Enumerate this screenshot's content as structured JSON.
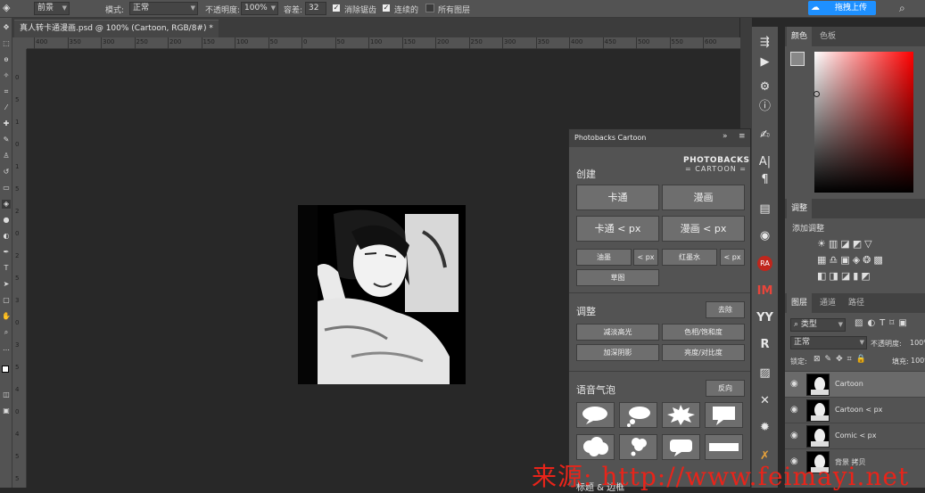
{
  "options_bar": {
    "mode_select": "前景",
    "mode_label": "模式:",
    "blend_select": "正常",
    "opacity_label": "不透明度:",
    "opacity_value": "100%",
    "tolerance_label": "容差:",
    "tolerance_value": "32",
    "antialias_label": "消除锯齿",
    "contiguous_label": "连续的",
    "all_layers_label": "所有图层",
    "upload_button": "拖拽上传"
  },
  "document": {
    "tab_title": "真人转卡通漫画.psd @ 100% (Cartoon, RGB/8#) *",
    "ruler_ticks": [
      "400",
      "350",
      "300",
      "250",
      "200",
      "150",
      "100",
      "50",
      "0",
      "50",
      "100",
      "150",
      "200",
      "250",
      "300",
      "350",
      "400",
      "450",
      "500",
      "550",
      "600",
      "650",
      "700",
      "750",
      "800",
      "850",
      "900",
      "950"
    ],
    "vruler_ticks": [
      "0",
      "5",
      "1",
      "0",
      "1",
      "5",
      "2",
      "0",
      "2",
      "5",
      "3",
      "0",
      "3",
      "5",
      "4",
      "0",
      "4",
      "5",
      "5"
    ]
  },
  "photobacks": {
    "title": "Photobacks Cartoon",
    "logo_line1": "PHOTOBACKS",
    "logo_line2": "= CARTOON =",
    "create_label": "创建",
    "cartoon_btn": "卡通",
    "comic_btn": "漫画",
    "cartoon_px_btn": "卡通 < px",
    "comic_px_btn": "漫画 < px",
    "oil_btn": "油墨",
    "oil_px_btn": "< px",
    "red_btn": "红墨水",
    "red_px_btn": "< px",
    "sketch_btn": "草图",
    "adjust_label": "调整",
    "remove_btn": "去除",
    "reduce_highlight_btn": "减淡高光",
    "hue_sat_btn": "色相/饱和度",
    "deepen_shadow_btn": "加深阴影",
    "brightness_btn": "亮度/对比度",
    "bubbles_label": "语音气泡",
    "invert_btn": "反向",
    "bottom_label": "标题 & 边框"
  },
  "right_panel": {
    "color_tab": "颜色",
    "swatch_tab": "色板",
    "adjust_tab": "调整",
    "add_adjust_label": "添加调整",
    "layers_tab": "图层",
    "channels_tab": "通道",
    "paths_tab": "路径",
    "kind_select": "类型",
    "blend_select": "正常",
    "opacity_label": "不透明度:",
    "opacity_value": "100%",
    "lock_label": "锁定:",
    "fill_label": "填充:",
    "fill_value": "100%",
    "layers": [
      {
        "name": "Cartoon"
      },
      {
        "name": "Cartoon < px"
      },
      {
        "name": "Comic < px"
      },
      {
        "name": "背景 拷贝"
      }
    ]
  },
  "watermark": "来源: http://www.feimayi.net",
  "colors": {
    "accent": "#1e90ff",
    "hue_red": "#ff0000",
    "watermark": "#e8241a"
  }
}
